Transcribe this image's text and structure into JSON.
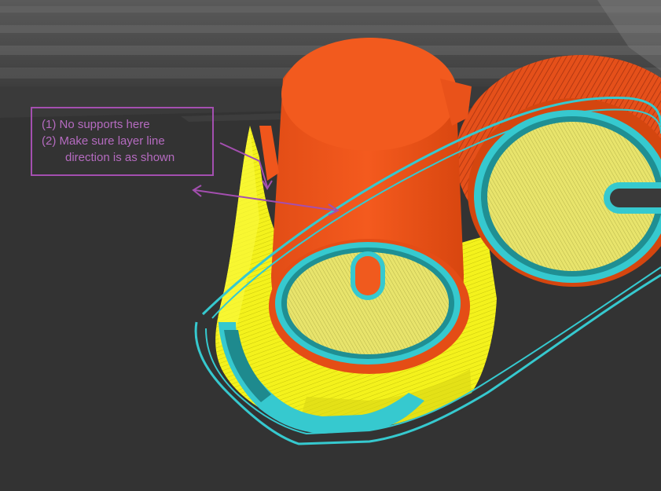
{
  "annotation": {
    "lines": [
      "(1) No supports here",
      "(2) Make sure layer line",
      "direction is as shown"
    ]
  },
  "colors": {
    "background": "#3b3b3b",
    "build_plate": "#2f2f2f",
    "model_wall": "#f2561c",
    "infill": "#e6e36a",
    "support": "#f2f21a",
    "travel_skirt": "#36c9cf",
    "annotation": "#a44fb0"
  },
  "icons": [
    "arrow-down-right",
    "arrow-double-headed"
  ]
}
